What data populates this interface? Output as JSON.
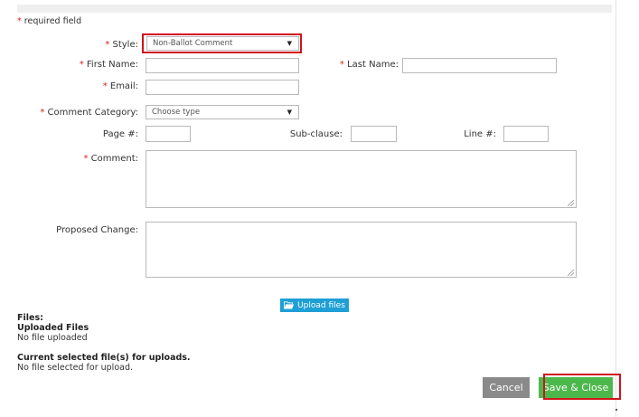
{
  "form": {
    "required_note": "required field",
    "asterisk": "*",
    "style_label": "Style:",
    "style_value": "Non-Ballot Comment",
    "first_name_label": "First Name:",
    "first_name_value": "",
    "last_name_label": "Last Name:",
    "last_name_value": "",
    "email_label": "Email:",
    "email_value": "",
    "category_label": "Comment Category:",
    "category_value": "Choose type",
    "page_label": "Page #:",
    "page_value": "",
    "subclause_label": "Sub-clause:",
    "subclause_value": "",
    "line_label": "Line #:",
    "line_value": "",
    "comment_label": "Comment:",
    "comment_value": "",
    "proposed_label": "Proposed Change:",
    "proposed_value": "",
    "dropdown_arrow": "▼"
  },
  "upload": {
    "button_label": "Upload files",
    "icon": "folder-icon"
  },
  "files": {
    "title": "Files:",
    "uploaded_heading": "Uploaded Files",
    "uploaded_status": "No file uploaded",
    "selected_heading": "Current selected file(s) for uploads.",
    "selected_status": "No file selected for upload."
  },
  "actions": {
    "cancel_label": "Cancel",
    "save_label": "Save & Close"
  },
  "colors": {
    "required": "#d9231c",
    "highlight": "#d2121b",
    "upload_button": "#1e9fd6",
    "save_button": "#4cb84c",
    "cancel_button": "#8a8a8a"
  }
}
